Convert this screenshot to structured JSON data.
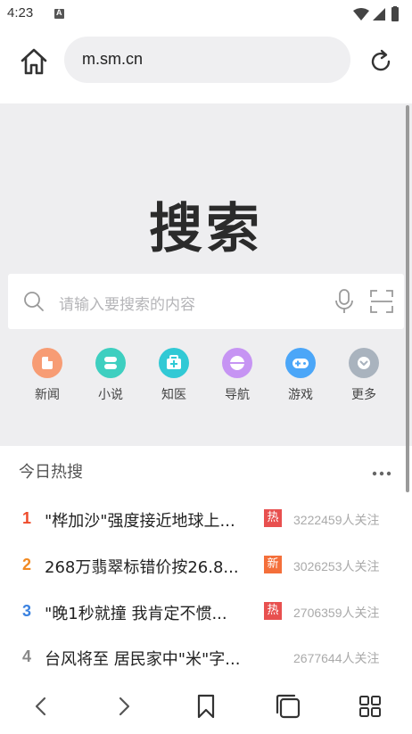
{
  "status_bar": {
    "time": "4:23",
    "notification_badge": "A"
  },
  "url_bar": {
    "url": "m.sm.cn"
  },
  "hero": {
    "logo": "搜索",
    "search_placeholder": "请输入要搜索的内容"
  },
  "quick_links": [
    {
      "label": "新闻",
      "color": "#f79c74",
      "icon": "news-icon"
    },
    {
      "label": "小说",
      "color": "#3ecfc0",
      "icon": "novel-icon"
    },
    {
      "label": "知医",
      "color": "#31c9d5",
      "icon": "medical-icon"
    },
    {
      "label": "导航",
      "color": "#c694f3",
      "icon": "navigation-icon"
    },
    {
      "label": "游戏",
      "color": "#4ba6f8",
      "icon": "game-icon"
    },
    {
      "label": "更多",
      "color": "#a9b3be",
      "icon": "more-icon"
    }
  ],
  "hot_search": {
    "title": "今日热搜",
    "items": [
      {
        "rank": "1",
        "rank_color": "#ee4b2b",
        "title": "\"桦加沙\"强度接近地球上...",
        "badge": "热",
        "badge_color": "#e8504f",
        "count": "3222459人关注"
      },
      {
        "rank": "2",
        "rank_color": "#f18a22",
        "title": "268万翡翠标错价按26.8...",
        "badge": "新",
        "badge_color": "#f46f3a",
        "count": "3026253人关注"
      },
      {
        "rank": "3",
        "rank_color": "#3b82e0",
        "title": "\"晚1秒就撞 我肯定不惯...",
        "badge": "热",
        "badge_color": "#e8504f",
        "count": "2706359人关注"
      },
      {
        "rank": "4",
        "rank_color": "#888888",
        "title": "台风将至 居民家中\"米\"字...",
        "badge": "",
        "badge_color": "",
        "count": "2677644人关注"
      }
    ]
  }
}
